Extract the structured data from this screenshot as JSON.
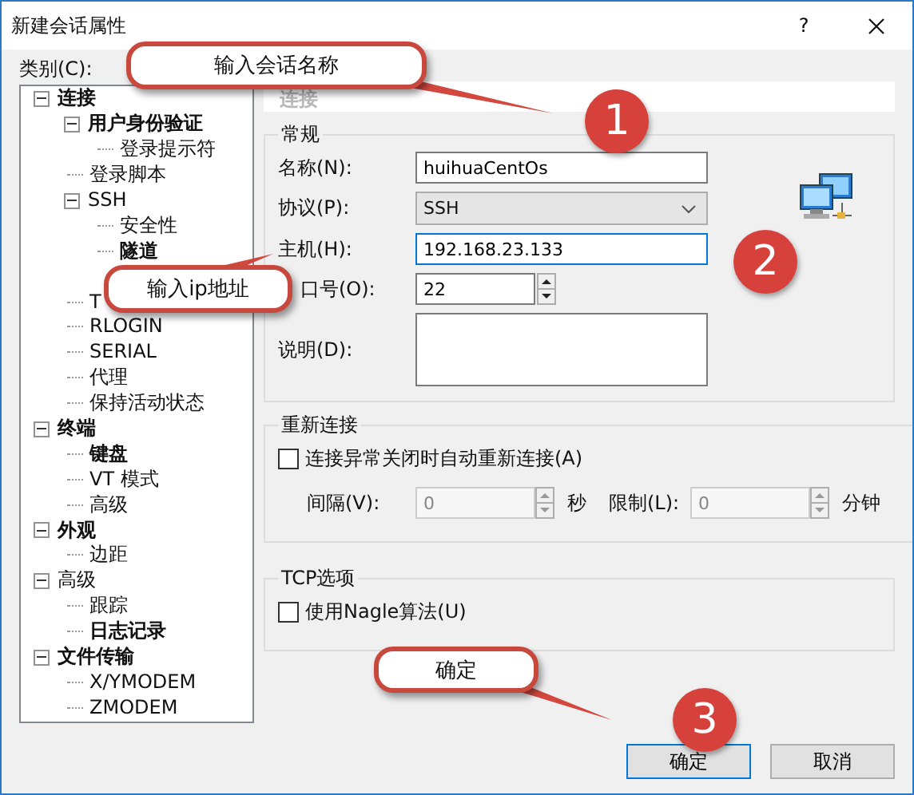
{
  "window": {
    "title": "新建会话属性",
    "help": "?"
  },
  "category_label": "类别(C):",
  "tree": [
    {
      "label": "连接",
      "bold": true,
      "expanded": true,
      "children": [
        {
          "label": "用户身份验证",
          "bold": true,
          "expanded": true,
          "children": [
            {
              "label": "登录提示符",
              "bold": false
            }
          ]
        },
        {
          "label": "登录脚本",
          "bold": false
        },
        {
          "label": "SSH",
          "bold": false,
          "expanded": true,
          "children": [
            {
              "label": "安全性",
              "bold": false
            },
            {
              "label": "隧道",
              "bold": true
            }
          ]
        },
        {
          "label": "T",
          "bold": false
        },
        {
          "label": "RLOGIN",
          "bold": false
        },
        {
          "label": "SERIAL",
          "bold": false
        },
        {
          "label": "代理",
          "bold": false
        },
        {
          "label": "保持活动状态",
          "bold": false
        }
      ]
    },
    {
      "label": "终端",
      "bold": true,
      "expanded": true,
      "children": [
        {
          "label": "键盘",
          "bold": true
        },
        {
          "label": "VT 模式",
          "bold": false
        },
        {
          "label": "高级",
          "bold": false
        }
      ]
    },
    {
      "label": "外观",
      "bold": true,
      "expanded": true,
      "children": [
        {
          "label": "边距",
          "bold": false
        }
      ]
    },
    {
      "label": "高级",
      "bold": false,
      "expanded": true,
      "children": [
        {
          "label": "跟踪",
          "bold": false
        },
        {
          "label": "日志记录",
          "bold": true
        }
      ]
    },
    {
      "label": "文件传输",
      "bold": true,
      "expanded": true,
      "children": [
        {
          "label": "X/YMODEM",
          "bold": false
        },
        {
          "label": "ZMODEM",
          "bold": false
        }
      ]
    }
  ],
  "panel": {
    "header": "连接",
    "general": {
      "title": "常规",
      "name_label": "名称(N):",
      "name_value": "huihuaCentOs",
      "protocol_label": "协议(P):",
      "protocol_value": "SSH",
      "host_label": "主机(H):",
      "host_value": "192.168.23.133",
      "port_label": "口号(O):",
      "port_value": "22",
      "description_label": "说明(D):"
    },
    "reconnect": {
      "title": "重新连接",
      "checkbox": {
        "label": "连接异常关闭时自动重新连接(A)",
        "checked": false
      },
      "interval_label": "间隔(V):",
      "interval_value": "0",
      "interval_unit": "秒",
      "limit_label": "限制(L):",
      "limit_value": "0",
      "limit_unit": "分钟",
      "disabled": true
    },
    "tcp": {
      "title": "TCP选项",
      "checkbox": {
        "label": "使用Nagle算法(U)",
        "checked": false
      }
    }
  },
  "buttons": [
    {
      "label": "确定",
      "kind": "default"
    },
    {
      "label": "取消",
      "kind": "normal"
    }
  ],
  "annotations": {
    "callouts": [
      {
        "text": "输入会话名称"
      },
      {
        "text": "输入ip地址"
      },
      {
        "text": "确定"
      }
    ],
    "steps": [
      "1",
      "2",
      "3"
    ]
  }
}
